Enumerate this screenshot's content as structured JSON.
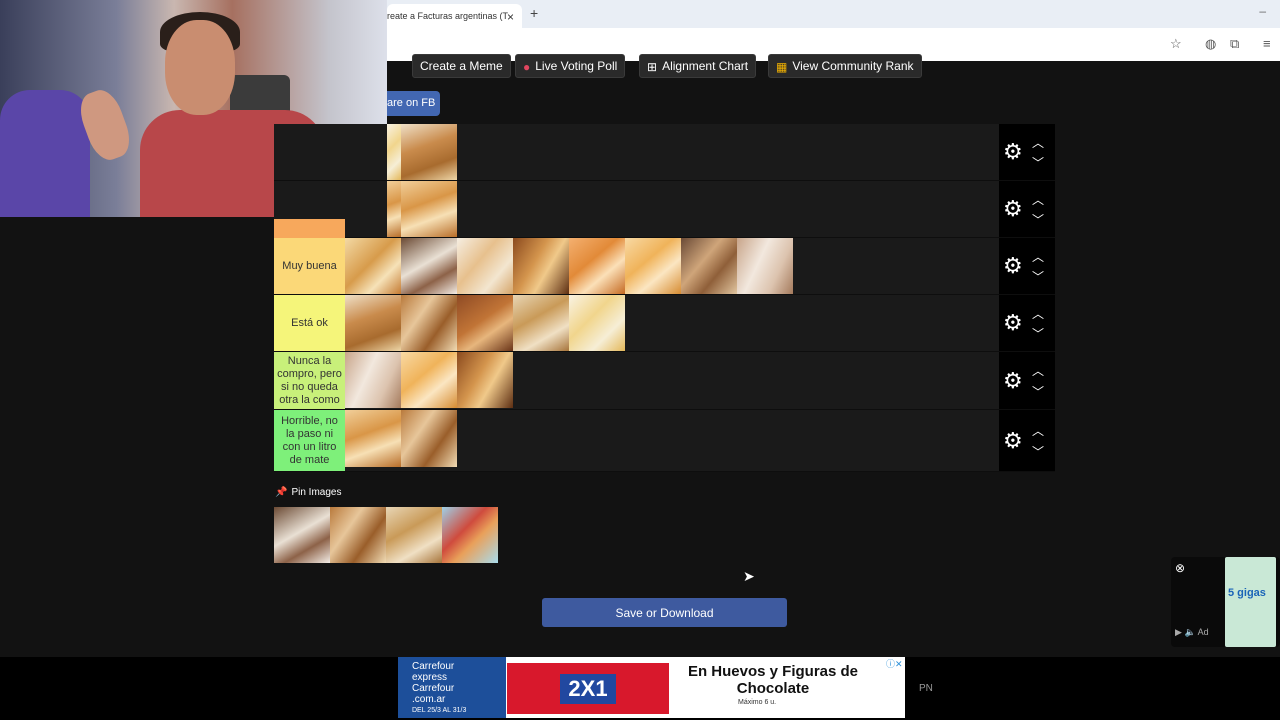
{
  "browser": {
    "tab_title": "reate a Facturas argentinas (T",
    "tab_close": "×",
    "new_tab": "+",
    "minimize": "–"
  },
  "toolbar": {
    "buttons": [
      {
        "label": "Create a Meme",
        "icon": ""
      },
      {
        "label": "Live Voting Poll",
        "icon": "red-dot-icon"
      },
      {
        "label": "Alignment Chart",
        "icon": "grid-icon"
      },
      {
        "label": "View Community Rank",
        "icon": "colorful-grid-icon"
      }
    ],
    "share_label": "are on FB"
  },
  "tiers": [
    {
      "label": "",
      "color": "#1a1a1a",
      "items": [
        "food-i",
        "food-b"
      ]
    },
    {
      "label": "",
      "color": "#1a1a1a",
      "items": [
        "food-l"
      ]
    },
    {
      "label": "Muy buena",
      "color": "#fbd878",
      "items": [
        "food-a",
        "food-e",
        "food-f",
        "food-c",
        "food-d",
        "food-k",
        "food-m",
        "food-j"
      ]
    },
    {
      "label": "Está ok",
      "color": "#f5f57a",
      "items": [
        "food-b",
        "food-g",
        "food-h",
        "food-n",
        "food-i"
      ]
    },
    {
      "label": "Nunca la compro, pero si no queda otra la como",
      "color": "#c8f07a",
      "items": [
        "food-j",
        "food-k",
        "food-c"
      ]
    },
    {
      "label": "Horrible, no la paso ni con un litro de mate",
      "color": "#7ef07a",
      "items": [
        "food-l",
        "food-g"
      ]
    }
  ],
  "pin_images": {
    "label": "Pin Images",
    "items": [
      "food-e",
      "food-g",
      "food-n",
      "food-o"
    ]
  },
  "save_button": "Save or Download",
  "bottom_ad": {
    "brand_line1": "Carrefour",
    "brand_line2": "express",
    "brand_line3": "Carrefour",
    "brand_line4": ".com.ar",
    "dates": "DEL 25/3 AL 31/3",
    "promo": "2X1",
    "headline": "En Huevos y Figuras de Chocolate",
    "limit": "Máximo 6 u."
  },
  "pn_label": "PN",
  "side_ad": {
    "card_text": "5 gigas",
    "controls": "Ad"
  }
}
